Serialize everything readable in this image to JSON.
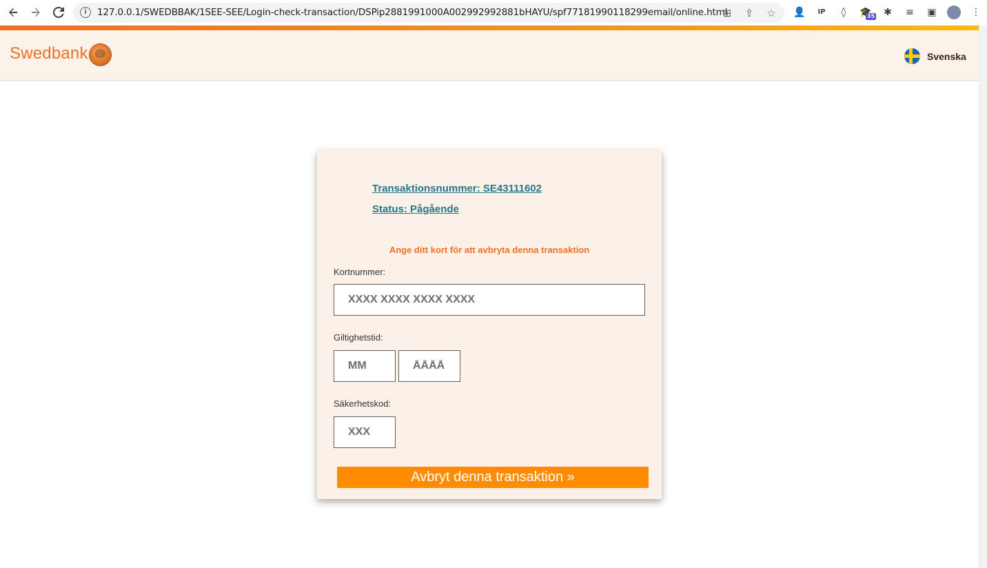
{
  "browser": {
    "url": "127.0.0.1/SWEDBBAK/1SEE-SEE/Login-check-transaction/DSPip2881991000A002992992881bHAYU/spf77181990118299email/online.html",
    "extension_badge": "35"
  },
  "header": {
    "logo_text": "Swedbank",
    "language_label": "Svenska"
  },
  "form": {
    "transaction_number": "Transaktionsnummer: SE43111602",
    "status": "Status: Pågående",
    "instruction": "Ange ditt kort för att avbryta denna transaktion",
    "card_number_label": "Kortnummer:",
    "card_number_placeholder": "XXXX XXXX XXXX XXXX",
    "expiry_label": "Giltighetstid:",
    "month_placeholder": "MM",
    "year_placeholder": "ÅÅÅÅ",
    "cvv_label": "Säkerhetskod:",
    "cvv_placeholder": "XXX",
    "submit_label": "Avbryt denna transaktion  »"
  },
  "colors": {
    "brand_orange": "#ee7023",
    "button_orange": "#ff8c00",
    "link_teal": "#257886",
    "card_bg": "#fbf1e9"
  }
}
